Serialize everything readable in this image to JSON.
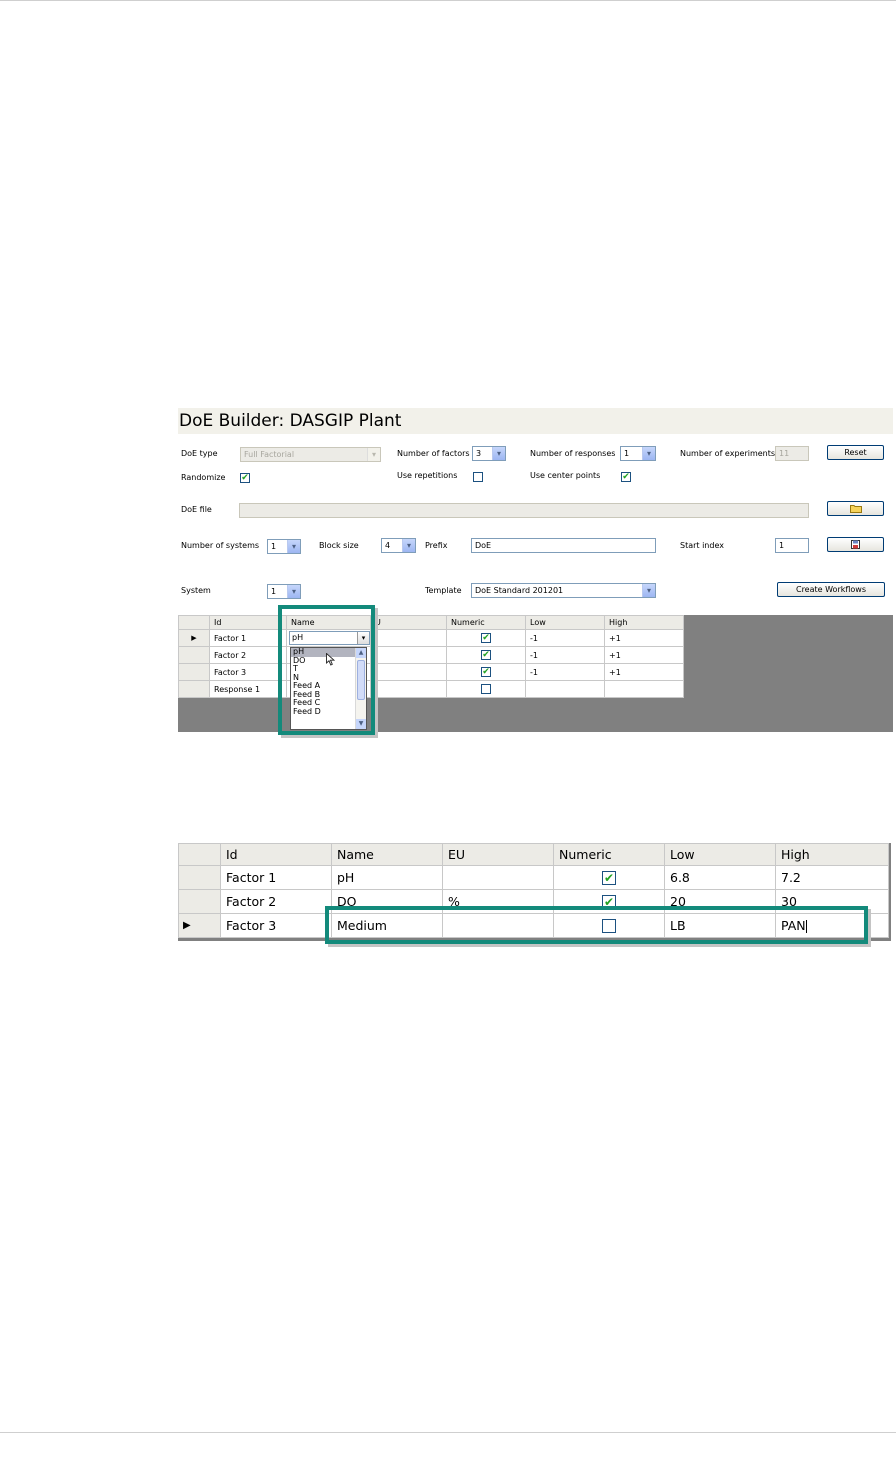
{
  "builder": {
    "title": "DoE Builder: DASGIP Plant",
    "doe_type_label": "DoE type",
    "doe_type_value": "Full Factorial",
    "num_factors_label": "Number of factors",
    "num_factors_value": "3",
    "num_responses_label": "Number of responses",
    "num_responses_value": "1",
    "num_experiments_label": "Number of experiments",
    "num_experiments_value": "11",
    "reset_label": "Reset",
    "randomize_label": "Randomize",
    "use_repetitions_label": "Use repetitions",
    "use_center_points_label": "Use center points",
    "doe_file_label": "DoE file",
    "doe_file_value": "",
    "num_systems_label": "Number of systems",
    "num_systems_value": "1",
    "block_size_label": "Block size",
    "block_size_value": "4",
    "prefix_label": "Prefix",
    "prefix_value": "DoE",
    "start_index_label": "Start index",
    "start_index_value": "1",
    "system_label": "System",
    "system_value": "1",
    "template_label": "Template",
    "template_value": "DoE Standard 201201",
    "create_workflows_label": "Create Workflows",
    "folder_icon": "folder-icon",
    "save_icon": "save-icon",
    "grid": {
      "headers": [
        "Id",
        "Name",
        "EU",
        "Numeric",
        "Low",
        "High"
      ],
      "headers_visible": [
        "Id",
        "Name",
        "U",
        "Numeric",
        "Low",
        "High"
      ],
      "rows": [
        {
          "id": "Factor 1",
          "name": "pH",
          "eu": "",
          "numeric": true,
          "low": "-1",
          "high": "+1"
        },
        {
          "id": "Factor 2",
          "name": "",
          "eu": "",
          "numeric": true,
          "low": "-1",
          "high": "+1"
        },
        {
          "id": "Factor 3",
          "name": "",
          "eu": "",
          "numeric": true,
          "low": "-1",
          "high": "+1"
        },
        {
          "id": "Response 1",
          "name": "",
          "eu": "",
          "numeric": false,
          "low": "",
          "high": ""
        }
      ]
    },
    "dropdown_options": [
      "pH",
      "DO",
      "T",
      "N",
      "Feed A",
      "Feed B",
      "Feed C",
      "Feed D"
    ],
    "dropdown_selected": "pH"
  },
  "grid2": {
    "headers": [
      "Id",
      "Name",
      "EU",
      "Numeric",
      "Low",
      "High"
    ],
    "rows": [
      {
        "id": "Factor 1",
        "name": "pH",
        "eu": "",
        "numeric": true,
        "low": "6.8",
        "high": "7.2"
      },
      {
        "id": "Factor 2",
        "name": "DO",
        "eu": "%",
        "numeric": true,
        "low": "20",
        "high": "30"
      },
      {
        "id": "Factor 3",
        "name": "Medium",
        "eu": "",
        "numeric": false,
        "low": "LB",
        "high": "PAN"
      }
    ]
  },
  "colors": {
    "highlight": "#138a7b",
    "check": "#21a121",
    "grid_background": "#808080"
  }
}
